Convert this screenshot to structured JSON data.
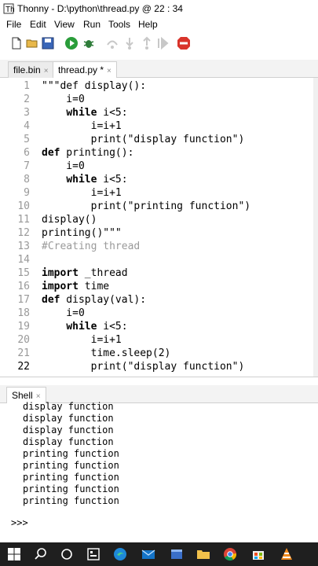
{
  "window": {
    "title": "Thonny  -  D:\\python\\thread.py  @  22 : 34"
  },
  "menu": [
    "File",
    "Edit",
    "View",
    "Run",
    "Tools",
    "Help"
  ],
  "toolbar": {
    "icons": [
      "new-file-icon",
      "open-folder-icon",
      "save-icon",
      "run-icon",
      "debug-icon",
      "step-over-icon",
      "step-into-icon",
      "step-out-icon",
      "resume-icon",
      "stop-icon"
    ]
  },
  "tabs": [
    {
      "label": "file.bin",
      "close": "×"
    },
    {
      "label": "thread.py *",
      "close": "×"
    }
  ],
  "editor": {
    "line_numbers": [
      "1",
      "2",
      "3",
      "4",
      "5",
      "6",
      "7",
      "8",
      "9",
      "10",
      "11",
      "12",
      "13",
      "14",
      "15",
      "16",
      "17",
      "18",
      "19",
      "20",
      "21",
      "22"
    ],
    "lines": [
      "\"\"\"def display():",
      "    i=0",
      "    while i<5:",
      "        i=i+1",
      "        print(\"display function\")",
      "def printing():",
      "    i=0",
      "    while i<5:",
      "        i=i+1",
      "        print(\"printing function\")",
      "display()",
      "printing()\"\"\"",
      "#Creating thread",
      "",
      "import _thread",
      "import time",
      "def display(val):",
      "    i=0",
      "    while i<5:",
      "        i=i+1",
      "        time.sleep(2)",
      "        print(\"display function\")"
    ]
  },
  "shell": {
    "tab_label": "Shell",
    "tab_close": "×",
    "output": [
      "display function",
      "display function",
      "display function",
      "display function",
      "printing function",
      "printing function",
      "printing function",
      "printing function",
      "printing function"
    ],
    "prompt": ">>>"
  },
  "taskbar": {
    "icons": [
      "windows-start-icon",
      "search-icon",
      "task-view-icon",
      "widgets-icon",
      "edge-icon",
      "mail-icon",
      "file-explorer-icon",
      "folder-icon",
      "chrome-icon",
      "microsoft-store-icon",
      "vlc-icon"
    ]
  },
  "colors": {
    "accent_run": "#2a9d3a",
    "stop": "#d9342b",
    "taskbar": "#1f1f1f"
  }
}
